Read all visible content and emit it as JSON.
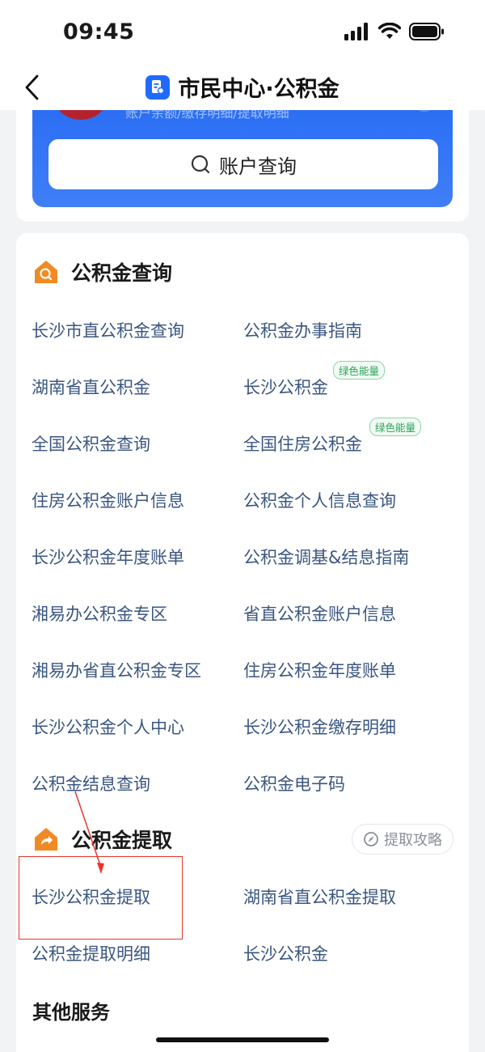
{
  "status_bar": {
    "time": "09:45"
  },
  "nav": {
    "title": "市民中心·公积金"
  },
  "account_card": {
    "subtitle": "账户余额/缴存明细/提取明细",
    "query_button": "账户查询",
    "colors": {
      "panel": "#2a6df4",
      "badge": "#b3232e"
    }
  },
  "query_section": {
    "title": "公积金查询",
    "icon": "home-search-icon",
    "items": [
      {
        "label": "长沙市直公积金查询"
      },
      {
        "label": "公积金办事指南"
      },
      {
        "label": "湖南省直公积金"
      },
      {
        "label": "长沙公积金",
        "tag": "绿色能量"
      },
      {
        "label": "全国公积金查询"
      },
      {
        "label": "全国住房公积金",
        "tag": "绿色能量"
      },
      {
        "label": "住房公积金账户信息"
      },
      {
        "label": "公积金个人信息查询"
      },
      {
        "label": "长沙公积金年度账单"
      },
      {
        "label": "公积金调基&结息指南"
      },
      {
        "label": "湘易办公积金专区"
      },
      {
        "label": "省直公积金账户信息"
      },
      {
        "label": "湘易办省直公积金专区"
      },
      {
        "label": "住房公积金年度账单"
      },
      {
        "label": "长沙公积金个人中心"
      },
      {
        "label": "长沙公积金缴存明细"
      },
      {
        "label": "公积金结息查询"
      },
      {
        "label": "公积金电子码"
      }
    ]
  },
  "withdraw_section": {
    "title": "公积金提取",
    "icon": "home-share-icon",
    "guide_button": "提取攻略",
    "items": [
      {
        "label": "长沙公积金提取"
      },
      {
        "label": "湖南省直公积金提取"
      },
      {
        "label": "公积金提取明细"
      },
      {
        "label": "长沙公积金"
      }
    ]
  },
  "other_section": {
    "title": "其他服务"
  },
  "colors": {
    "link": "#3a5680",
    "accent": "#f08a24",
    "tag_green": "#2aa55a",
    "annotation": "#e8362d"
  }
}
